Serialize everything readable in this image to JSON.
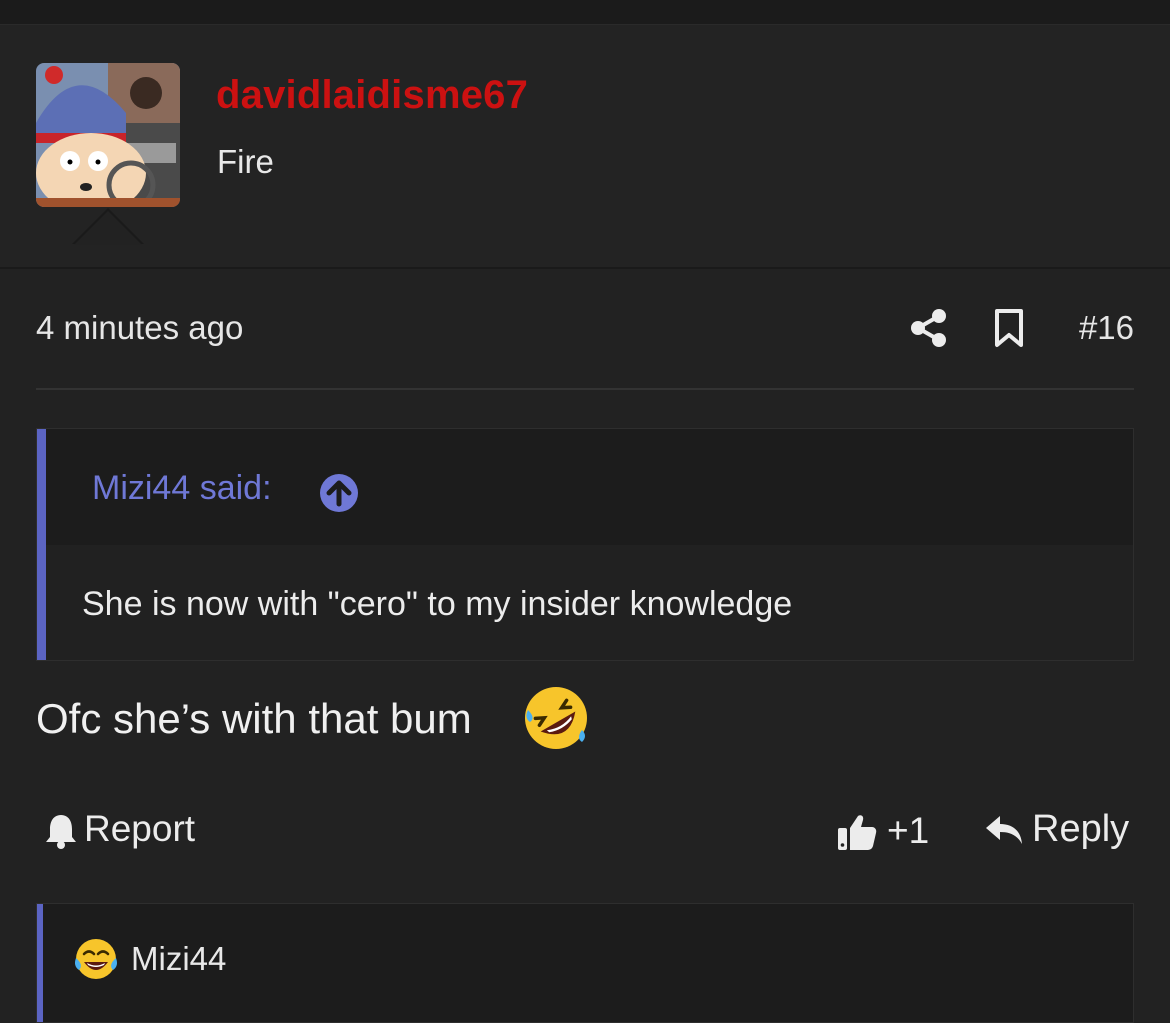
{
  "post": {
    "author": "davidlaidisme67",
    "author_title": "Fire",
    "timestamp": "4 minutes ago",
    "post_number": "#16",
    "quote": {
      "author_label": "Mizi44 said:",
      "text": "She is now with \"cero\" to my insider knowledge"
    },
    "message": "Ofc she’s with that bum",
    "actions": {
      "report": "Report",
      "like_count": "+1",
      "reply": "Reply"
    },
    "reactions": {
      "users": "Mizi44"
    }
  },
  "colors": {
    "background": "#222222",
    "username": "#cc1111",
    "accent": "#5b64c3",
    "quote_link": "#6f78d6"
  }
}
